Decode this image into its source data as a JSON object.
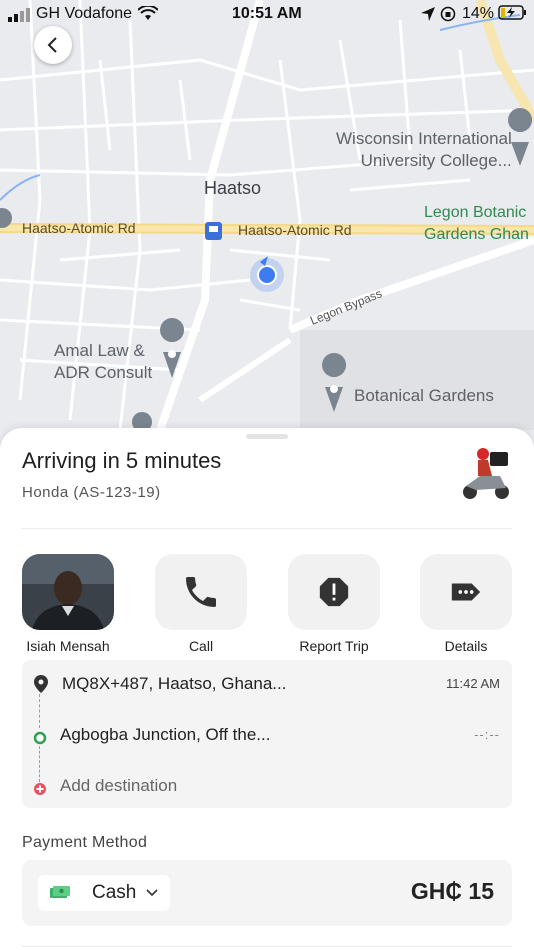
{
  "status_bar": {
    "carrier": "GH Vodafone",
    "time": "10:51 AM",
    "battery": "14%"
  },
  "map": {
    "area_label": "Haatso",
    "roads": [
      "Haatso-Atomic Rd",
      "Haatso-Atomic Rd",
      "Legon Bypass"
    ],
    "places": {
      "wisconsin_1": "Wisconsin International",
      "wisconsin_2": "University College...",
      "legon_1": "Legon Botanic",
      "legon_2": "Gardens Ghan",
      "amal_1": "Amal Law &",
      "amal_2": "ADR Consult",
      "botanical": "Botanical Gardens"
    }
  },
  "trip": {
    "arriving": "Arriving in 5 minutes",
    "vehicle": "Honda (AS-123-19)"
  },
  "actions": {
    "driver_name": "Isiah Mensah",
    "call": "Call",
    "report": "Report Trip",
    "details": "Details"
  },
  "route": {
    "pickup": "MQ8X+487, Haatso, Ghana...",
    "pickup_time": "11:42 AM",
    "stop": "Agbogba Junction, Off the...",
    "stop_time": "--:--",
    "add_destination": "Add destination"
  },
  "payment": {
    "title": "Payment Method",
    "method": "Cash",
    "price": "GH₵ 15"
  },
  "colors": {
    "accent_blue": "#3d7bf0",
    "pin_green": "#2e9e4f",
    "pin_red": "#e05566",
    "cash_green": "#3bb36b"
  }
}
